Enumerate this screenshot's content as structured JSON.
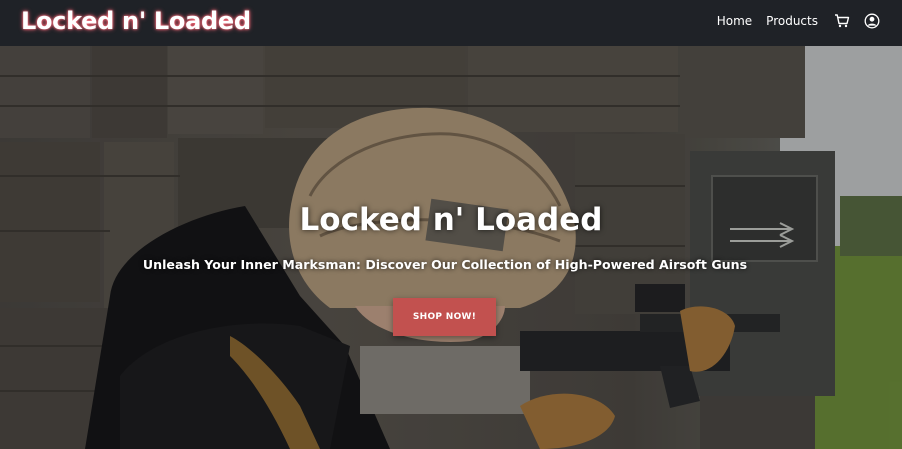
{
  "navbar": {
    "brand": "Locked n' Loaded",
    "links": [
      {
        "label": "Home"
      },
      {
        "label": "Products"
      }
    ],
    "icons": [
      "cart-icon",
      "user-account-icon"
    ]
  },
  "hero": {
    "title": "Locked n' Loaded",
    "subtitle": "Unleash Your Inner Marksman: Discover Our Collection of High-Powered Airsoft Guns",
    "cta_label": "SHOP NOW!",
    "background_image": "airsoft-player-with-helmet-aiming-rifle",
    "colors": {
      "navbar_bg": "#1f2227",
      "brand_glow": "#ff5d6e",
      "cta_bg": "#c2514f",
      "text": "#ffffff"
    }
  }
}
